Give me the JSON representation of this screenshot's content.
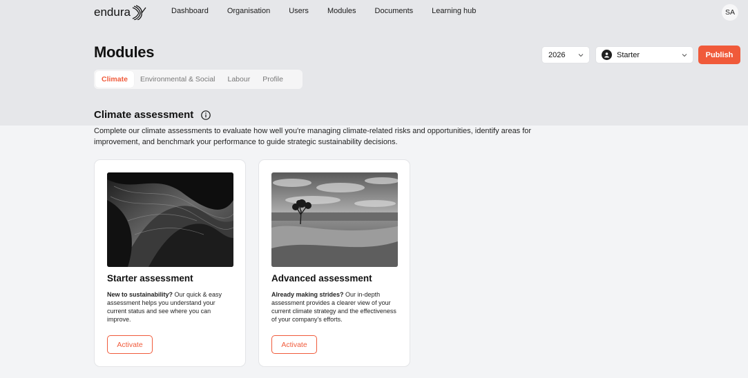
{
  "brand": {
    "name": "endura"
  },
  "nav": [
    "Dashboard",
    "Organisation",
    "Users",
    "Modules",
    "Documents",
    "Learning hub"
  ],
  "user": {
    "initials": "SA"
  },
  "page": {
    "title": "Modules"
  },
  "controls": {
    "year": "2026",
    "plan": "Starter",
    "publish_label": "Publish"
  },
  "tabs": [
    {
      "label": "Climate",
      "active": true
    },
    {
      "label": "Environmental & Social",
      "active": false
    },
    {
      "label": "Labour",
      "active": false
    },
    {
      "label": "Profile",
      "active": false
    }
  ],
  "section": {
    "title": "Climate assessment",
    "description": "Complete our climate assessments to evaluate how well you're managing climate-related risks and opportunities, identify areas for improvement, and benchmark your performance to guide strategic sustainability decisions."
  },
  "cards": [
    {
      "title": "Starter assessment",
      "lead": "New to sustainability?",
      "body": " Our quick & easy assessment helps you understand your current status and see where you can improve.",
      "button": "Activate"
    },
    {
      "title": "Advanced assessment",
      "lead": "Already making strides?",
      "body": " Our in-depth assessment provides a clearer view of your current climate strategy and the effectiveness of your company's efforts.",
      "button": "Activate"
    }
  ],
  "colors": {
    "accent": "#f05a3a",
    "header_bg": "#e6e7ea",
    "page_bg": "#f3f4f6"
  },
  "icons": {
    "info": "info-icon",
    "chevron": "chevron-down-icon",
    "plan": "plan-badge-icon"
  }
}
